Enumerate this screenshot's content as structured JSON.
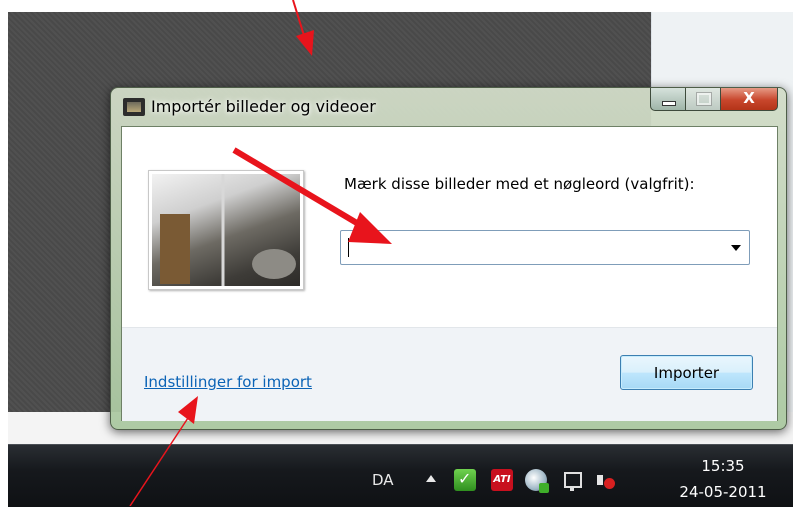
{
  "window": {
    "title": "Importér billeder og videoer",
    "close_glyph": "X"
  },
  "dialog": {
    "prompt": "Mærk disse billeder med et nøgleord (valgfrit):",
    "tag_input_value": "",
    "settings_link": "Indstillinger for import",
    "import_button": "Importer"
  },
  "taskbar": {
    "language": "DA",
    "ati_label": "ATI",
    "time": "15:35",
    "date": "24-05-2011"
  },
  "colors": {
    "annotation_arrow": "#e8141c",
    "link": "#0b63b6",
    "desktop": "#4b4b4b"
  },
  "icons": [
    "app-import-icon",
    "sync-tray-icon",
    "ati-tray-icon",
    "disk-tray-icon",
    "network-tray-icon",
    "volume-muted-icon",
    "show-hidden-icons-arrow"
  ]
}
